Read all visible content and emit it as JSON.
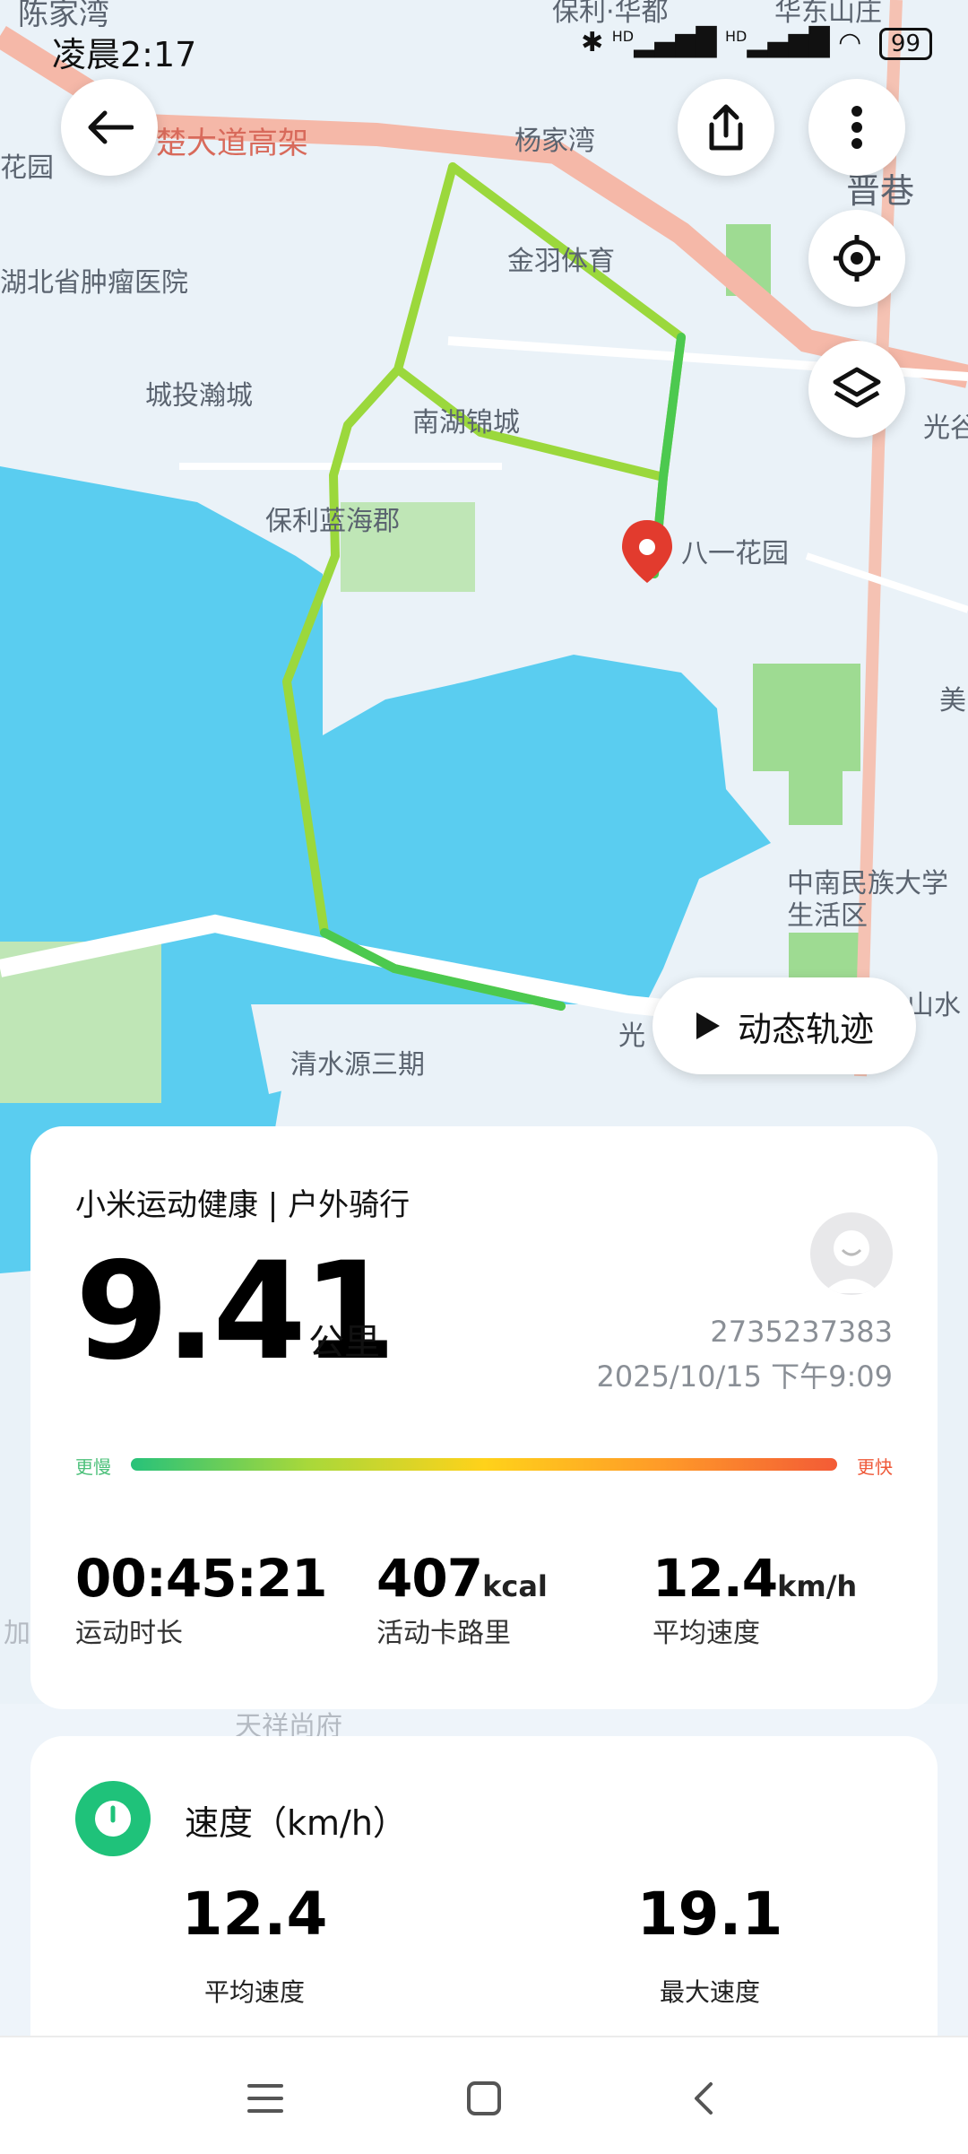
{
  "status_bar": {
    "time": "凌晨2:17",
    "signal1": "HD",
    "signal2": "HD",
    "battery": "99"
  },
  "map": {
    "labels": {
      "chenjiawan": "陈家湾",
      "baoli_huadu": "保利·华都",
      "huadongshan": "华东山庄",
      "dadao": "楚大道高架",
      "yangjiawan": "杨家湾",
      "huayuan": "花园",
      "xiang": "晋巷",
      "hospital": "湖北省肿瘤医院",
      "jinyu": "金羽体育",
      "chengtou": "城投瀚城",
      "nanhu": "南湖锦城",
      "guang_right": "光谷",
      "lanhai": "保利蓝海郡",
      "bayi": "八一花园",
      "mei": "美",
      "zhongnan": "中南民族大学生活区",
      "shanshui": "山水",
      "guang_bottom": "光",
      "qingshuiyuan": "清水源三期",
      "tianxiang": "天祥尚府",
      "jia": "加"
    }
  },
  "dynamic_track_label": "动态轨迹",
  "summary": {
    "title": "小米运动健康 | 户外骑行",
    "distance": "9.41",
    "distance_unit": "公里",
    "user_id": "2735237383",
    "datetime": "2025/10/15 下午9:09",
    "slower_label": "更慢",
    "faster_label": "更快",
    "stats": [
      {
        "value": "00:45:21",
        "unit": "",
        "label": "运动时长"
      },
      {
        "value": "407",
        "unit": "kcal",
        "label": "活动卡路里"
      },
      {
        "value": "12.4",
        "unit": "km/h",
        "label": "平均速度"
      }
    ]
  },
  "speed": {
    "title": "速度（km/h）",
    "avg_value": "12.4",
    "avg_label": "平均速度",
    "max_value": "19.1",
    "max_label": "最大速度"
  },
  "colors": {
    "track_light": "#a8d83a",
    "track_dark": "#4cc94f",
    "water": "#5acdf0",
    "accent_green": "#1fc27a",
    "pin_red": "#e23b2e"
  }
}
